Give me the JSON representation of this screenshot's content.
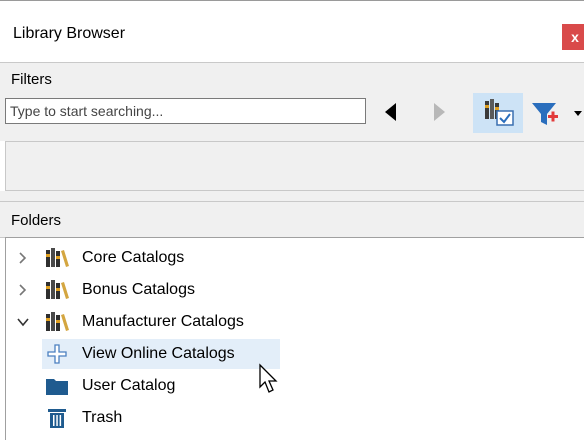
{
  "window": {
    "title": "Library Browser",
    "close_label": "x"
  },
  "filters": {
    "header": "Filters",
    "search_placeholder": "Type to start searching...",
    "icons": {
      "back": "arrow-left-icon",
      "forward": "arrow-right-icon",
      "toggle": "library-toggle-icon",
      "filter": "filter-add-icon"
    }
  },
  "folders": {
    "header": "Folders",
    "items": [
      {
        "label": "Core Catalogs",
        "icon": "catalog-books-icon",
        "expander": "collapsed"
      },
      {
        "label": "Bonus Catalogs",
        "icon": "catalog-books-icon",
        "expander": "collapsed"
      },
      {
        "label": "Manufacturer Catalogs",
        "icon": "catalog-books-icon",
        "expander": "expanded"
      },
      {
        "label": "View Online Catalogs",
        "icon": "plus-cross-icon",
        "expander": "none",
        "highlighted": true
      },
      {
        "label": "User Catalog",
        "icon": "folder-icon",
        "expander": "none"
      },
      {
        "label": "Trash",
        "icon": "trash-icon",
        "expander": "none"
      }
    ]
  },
  "colors": {
    "close_button": "#d94a4a",
    "toggle_active": "#cde3f6",
    "highlight_row": "#e3eef9",
    "filter_red": "#e23b3b",
    "filter_blue": "#2a6ebd"
  }
}
